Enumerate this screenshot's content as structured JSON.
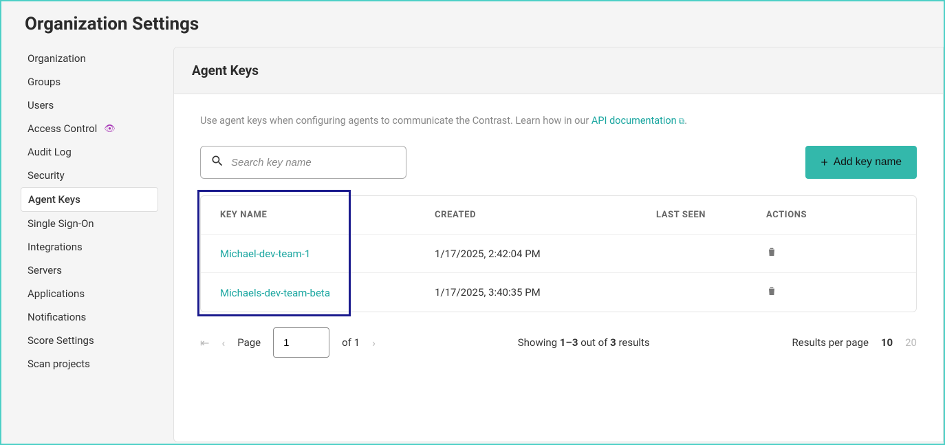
{
  "page": {
    "title": "Organization Settings"
  },
  "sidebar": {
    "items": [
      {
        "label": "Organization",
        "active": false,
        "eye": false
      },
      {
        "label": "Groups",
        "active": false,
        "eye": false
      },
      {
        "label": "Users",
        "active": false,
        "eye": false
      },
      {
        "label": "Access Control",
        "active": false,
        "eye": true
      },
      {
        "label": "Audit Log",
        "active": false,
        "eye": false
      },
      {
        "label": "Security",
        "active": false,
        "eye": false
      },
      {
        "label": "Agent Keys",
        "active": true,
        "eye": false
      },
      {
        "label": "Single Sign-On",
        "active": false,
        "eye": false
      },
      {
        "label": "Integrations",
        "active": false,
        "eye": false
      },
      {
        "label": "Servers",
        "active": false,
        "eye": false
      },
      {
        "label": "Applications",
        "active": false,
        "eye": false
      },
      {
        "label": "Notifications",
        "active": false,
        "eye": false
      },
      {
        "label": "Score Settings",
        "active": false,
        "eye": false
      },
      {
        "label": "Scan projects",
        "active": false,
        "eye": false
      }
    ]
  },
  "panel": {
    "title": "Agent Keys",
    "help_prefix": "Use agent keys when configuring agents to communicate the Contrast. Learn how in our ",
    "help_link": "API documentation",
    "help_suffix": "."
  },
  "search": {
    "placeholder": "Search key name",
    "value": ""
  },
  "add_button": {
    "label": "Add key name"
  },
  "table": {
    "columns": {
      "name": "KEY NAME",
      "created": "CREATED",
      "last_seen": "LAST SEEN",
      "actions": "ACTIONS"
    },
    "rows": [
      {
        "name": "Michael-dev-team-1",
        "created": "1/17/2025, 2:42:04 PM",
        "last_seen": ""
      },
      {
        "name": "Michaels-dev-team-beta",
        "created": "1/17/2025, 3:40:35 PM",
        "last_seen": ""
      }
    ]
  },
  "pagination": {
    "page_label": "Page",
    "page_value": "1",
    "of_label": "of 1",
    "showing_prefix": "Showing ",
    "showing_range": "1–3",
    "showing_mid": " out of ",
    "showing_total": "3",
    "showing_suffix": " results",
    "rpp_label": "Results per page",
    "rpp_options": [
      "10",
      "20"
    ],
    "rpp_selected": "10"
  }
}
